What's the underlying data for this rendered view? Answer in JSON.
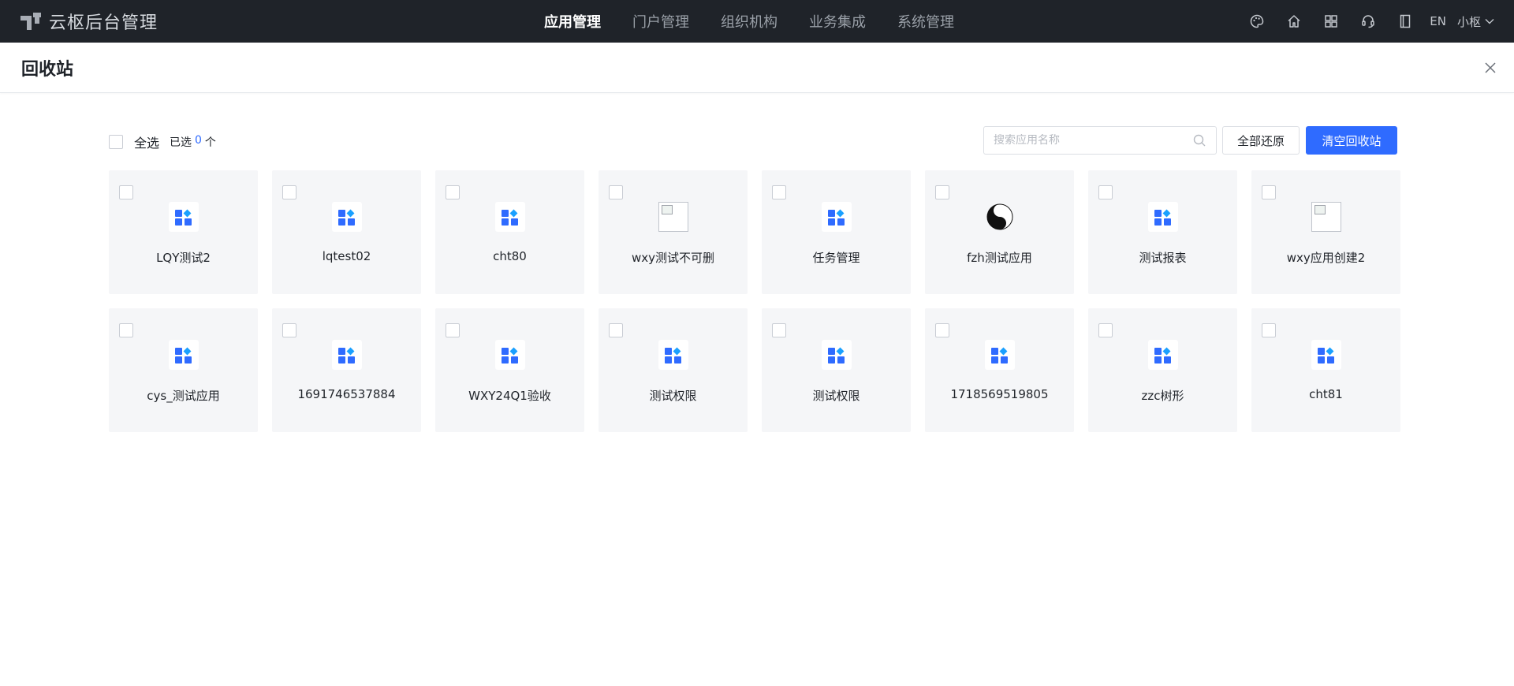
{
  "app": {
    "title": "云枢后台管理"
  },
  "nav": {
    "items": [
      {
        "label": "应用管理",
        "active": true
      },
      {
        "label": "门户管理",
        "active": false
      },
      {
        "label": "组织机构",
        "active": false
      },
      {
        "label": "业务集成",
        "active": false
      },
      {
        "label": "系统管理",
        "active": false
      }
    ]
  },
  "tools": {
    "icons": [
      "palette-icon",
      "home-icon",
      "apps-grid-icon",
      "headset-icon",
      "book-icon"
    ],
    "lang": "EN",
    "user": "小枢"
  },
  "page": {
    "title": "回收站"
  },
  "toolbar": {
    "select_all": "全选",
    "selected_prefix": "已选",
    "selected_count": "0",
    "selected_suffix": "个",
    "search_placeholder": "搜索应用名称",
    "restore_all": "全部还原",
    "clear_bin": "清空回收站"
  },
  "apps": [
    {
      "name": "LQY测试2",
      "icon": "app-grid"
    },
    {
      "name": "lqtest02",
      "icon": "app-grid"
    },
    {
      "name": "cht80",
      "icon": "app-grid"
    },
    {
      "name": "wxy测试不可删",
      "icon": "broken-image"
    },
    {
      "name": "任务管理",
      "icon": "app-grid"
    },
    {
      "name": "fzh测试应用",
      "icon": "yin-yang"
    },
    {
      "name": "测试报表",
      "icon": "app-grid"
    },
    {
      "name": "wxy应用创建2",
      "icon": "broken-image"
    },
    {
      "name": "cys_测试应用",
      "icon": "app-grid"
    },
    {
      "name": "1691746537884",
      "icon": "app-grid"
    },
    {
      "name": "WXY24Q1验收",
      "icon": "app-grid"
    },
    {
      "name": "测试权限",
      "icon": "app-grid"
    },
    {
      "name": "测试权限",
      "icon": "app-grid"
    },
    {
      "name": "1718569519805",
      "icon": "app-grid"
    },
    {
      "name": "zzc树形",
      "icon": "app-grid"
    },
    {
      "name": "cht81",
      "icon": "app-grid"
    }
  ],
  "colors": {
    "primary": "#2f6bff",
    "nav_bg": "#1f2329",
    "card_bg": "#f5f6f8"
  }
}
